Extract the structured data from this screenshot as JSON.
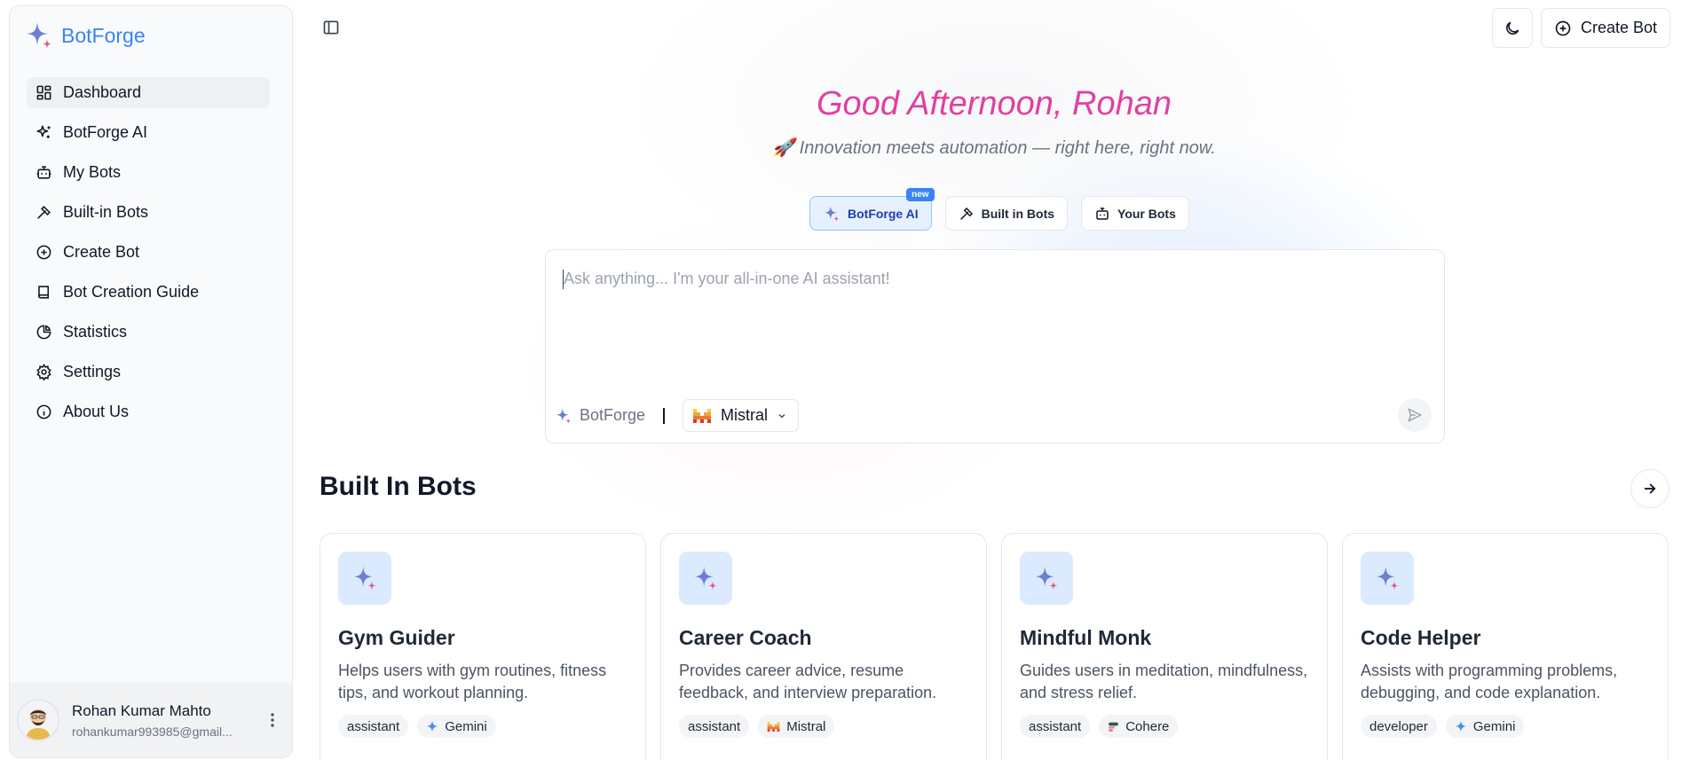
{
  "app": {
    "name": "BotForge"
  },
  "sidebar": {
    "items": [
      {
        "label": "Dashboard",
        "icon": "dashboard-icon",
        "active": true
      },
      {
        "label": "BotForge AI",
        "icon": "sparkles-icon"
      },
      {
        "label": "My Bots",
        "icon": "bot-icon"
      },
      {
        "label": "Built-in Bots",
        "icon": "hammer-icon"
      },
      {
        "label": "Create Bot",
        "icon": "plus-circle-icon"
      },
      {
        "label": "Bot Creation Guide",
        "icon": "book-icon"
      },
      {
        "label": "Statistics",
        "icon": "pie-chart-icon"
      },
      {
        "label": "Settings",
        "icon": "gear-icon"
      },
      {
        "label": "About Us",
        "icon": "info-icon"
      }
    ],
    "user": {
      "name": "Rohan Kumar Mahto",
      "email": "rohankumar993985@gmail..."
    }
  },
  "header": {
    "create_label": "Create Bot"
  },
  "hero": {
    "greeting": "Good Afternoon, Rohan",
    "tagline": "🚀 Innovation meets automation — right here, right now.",
    "tabs": [
      {
        "label": "BotForge AI",
        "badge": "new",
        "active": true
      },
      {
        "label": "Built in Bots"
      },
      {
        "label": "Your Bots"
      }
    ]
  },
  "prompt": {
    "placeholder": "Ask anything... I'm your all-in-one AI assistant!",
    "brand_label": "BotForge",
    "model": "Mistral"
  },
  "builtin": {
    "title": "Built In Bots",
    "cards": [
      {
        "title": "Gym Guider",
        "desc": "Helps users with gym routines, fitness tips, and workout planning.",
        "tags": [
          "assistant",
          "Gemini"
        ]
      },
      {
        "title": "Career Coach",
        "desc": "Provides career advice, resume feedback, and interview preparation.",
        "tags": [
          "assistant",
          "Mistral"
        ]
      },
      {
        "title": "Mindful Monk",
        "desc": "Guides users in meditation, mindfulness, and stress relief.",
        "tags": [
          "assistant",
          "Cohere"
        ]
      },
      {
        "title": "Code Helper",
        "desc": "Assists with programming problems, debugging, and code explanation.",
        "tags": [
          "developer",
          "Gemini"
        ]
      }
    ]
  },
  "colors": {
    "brand": "#3b82f6",
    "greeting": "#e040a0",
    "accent_blue": "#4f7fd9",
    "accent_pink": "#e25a8f"
  }
}
